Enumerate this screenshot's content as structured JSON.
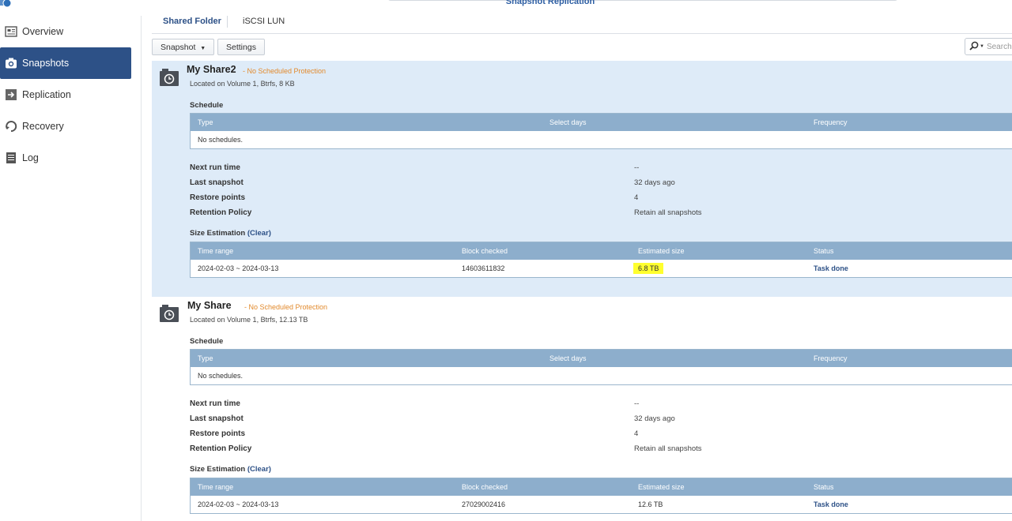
{
  "app": {
    "title": "Snapshot Replication"
  },
  "sidebar": {
    "items": [
      {
        "label": "Overview",
        "icon": "overview-icon",
        "active": false
      },
      {
        "label": "Snapshots",
        "icon": "camera-icon",
        "active": true
      },
      {
        "label": "Replication",
        "icon": "replication-icon",
        "active": false
      },
      {
        "label": "Recovery",
        "icon": "recovery-icon",
        "active": false
      },
      {
        "label": "Log",
        "icon": "log-icon",
        "active": false
      }
    ]
  },
  "tabs": [
    {
      "label": "Shared Folder",
      "active": true
    },
    {
      "label": "iSCSI LUN",
      "active": false
    }
  ],
  "toolbar": {
    "snapshot_label": "Snapshot",
    "settings_label": "Settings",
    "search_placeholder": "Search"
  },
  "labels": {
    "schedule": "Schedule",
    "schedule_columns": [
      "Type",
      "Select days",
      "Frequency"
    ],
    "size_estimation": "Size Estimation",
    "clear": "(Clear)",
    "size_columns": [
      "Time range",
      "Block checked",
      "Estimated size",
      "Status"
    ],
    "next_run_time": "Next run time",
    "last_snapshot": "Last snapshot",
    "restore_points": "Restore points",
    "retention_policy": "Retention Policy"
  },
  "shares": [
    {
      "name": "My Share2",
      "protection": "- No Scheduled Protection",
      "location": "Located on Volume 1, Btrfs, 8 KB",
      "schedule_empty": "No schedules.",
      "next_run_time": "--",
      "last_snapshot": "32 days ago",
      "restore_points": "4",
      "retention_policy": "Retain all snapshots",
      "size": {
        "time_range": "2024-02-03 ~ 2024-03-13",
        "block_checked": "14603611832",
        "estimated_size": "6.8 TB",
        "status": "Task done"
      }
    },
    {
      "name": "My Share",
      "protection": "- No Scheduled Protection",
      "location": "Located on Volume 1, Btrfs, 12.13 TB",
      "schedule_empty": "No schedules.",
      "next_run_time": "--",
      "last_snapshot": "32 days ago",
      "restore_points": "4",
      "retention_policy": "Retain all snapshots",
      "size": {
        "time_range": "2024-02-03 ~ 2024-03-13",
        "block_checked": "27029002416",
        "estimated_size": "12.6 TB",
        "status": "Task done"
      }
    }
  ],
  "colors": {
    "accent": "#2d5187",
    "selected_panel": "#deebf8",
    "grid_header": "#8daecc",
    "warning": "#e28a2d",
    "highlight": "#ffff2e"
  }
}
